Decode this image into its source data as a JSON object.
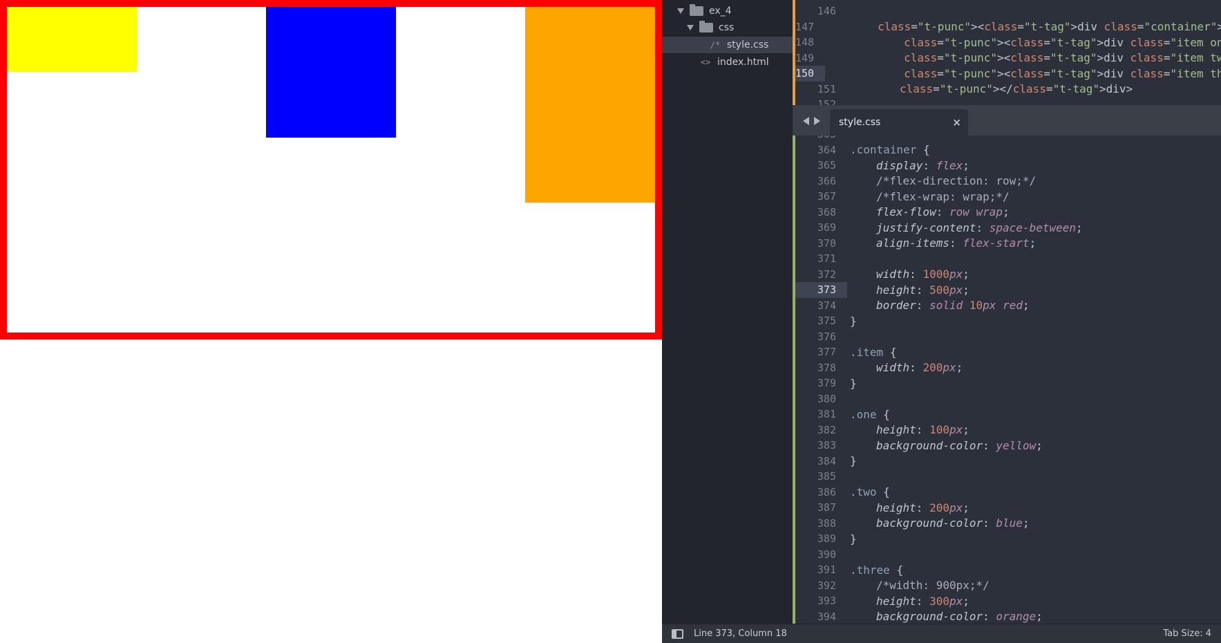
{
  "colors": {
    "container_border": "#ff0000",
    "item_one": "#ffff00",
    "item_two": "#0000ff",
    "item_three": "#ffa500"
  },
  "sidebar": {
    "items": [
      {
        "label": "ex_4",
        "icon": "folder-icon",
        "expanded": true
      },
      {
        "label": "css",
        "icon": "folder-icon",
        "expanded": true
      },
      {
        "label": "style.css",
        "icon": "/*",
        "selected": true
      },
      {
        "label": "index.html",
        "icon": "<>"
      }
    ]
  },
  "editor_top": {
    "line_numbers": [
      "146",
      "147",
      "148",
      "149",
      "150",
      "151",
      "152"
    ],
    "active_line": "150",
    "lines": [
      "",
      "<div class=\"container\">",
      "<div class=\"item one\"></div>",
      "<div class=\"item two\"></div>",
      "<div class=\"item three\"></div>",
      "</div>",
      ""
    ]
  },
  "tab": {
    "label": "style.css",
    "close_glyph": "×"
  },
  "editor_bottom": {
    "line_numbers": [
      "363",
      "364",
      "365",
      "366",
      "367",
      "368",
      "369",
      "370",
      "371",
      "372",
      "373",
      "374",
      "375",
      "376",
      "377",
      "378",
      "379",
      "380",
      "381",
      "382",
      "383",
      "384",
      "385",
      "386",
      "387",
      "388",
      "389",
      "390",
      "391",
      "392",
      "393",
      "394"
    ],
    "active_line": "373",
    "lines": [
      "",
      ".container {",
      "display: flex;",
      "/*flex-direction: row;*/",
      "/*flex-wrap: wrap;*/",
      "flex-flow: row wrap;",
      "justify-content: space-between;",
      "align-items: flex-start;",
      "",
      "width: 1000px;",
      "height: 500px;",
      "border: solid 10px red;",
      "}",
      "",
      ".item {",
      "width: 200px;",
      "}",
      "",
      ".one {",
      "height: 100px;",
      "background-color: yellow;",
      "}",
      "",
      ".two {",
      "height: 200px;",
      "background-color: blue;",
      "}",
      "",
      ".three {",
      "/*width: 900px;*/",
      "height: 300px;",
      "background-color: orange;"
    ]
  },
  "status": {
    "position": "Line 373, Column 18",
    "tab_size": "Tab Size: 4"
  }
}
